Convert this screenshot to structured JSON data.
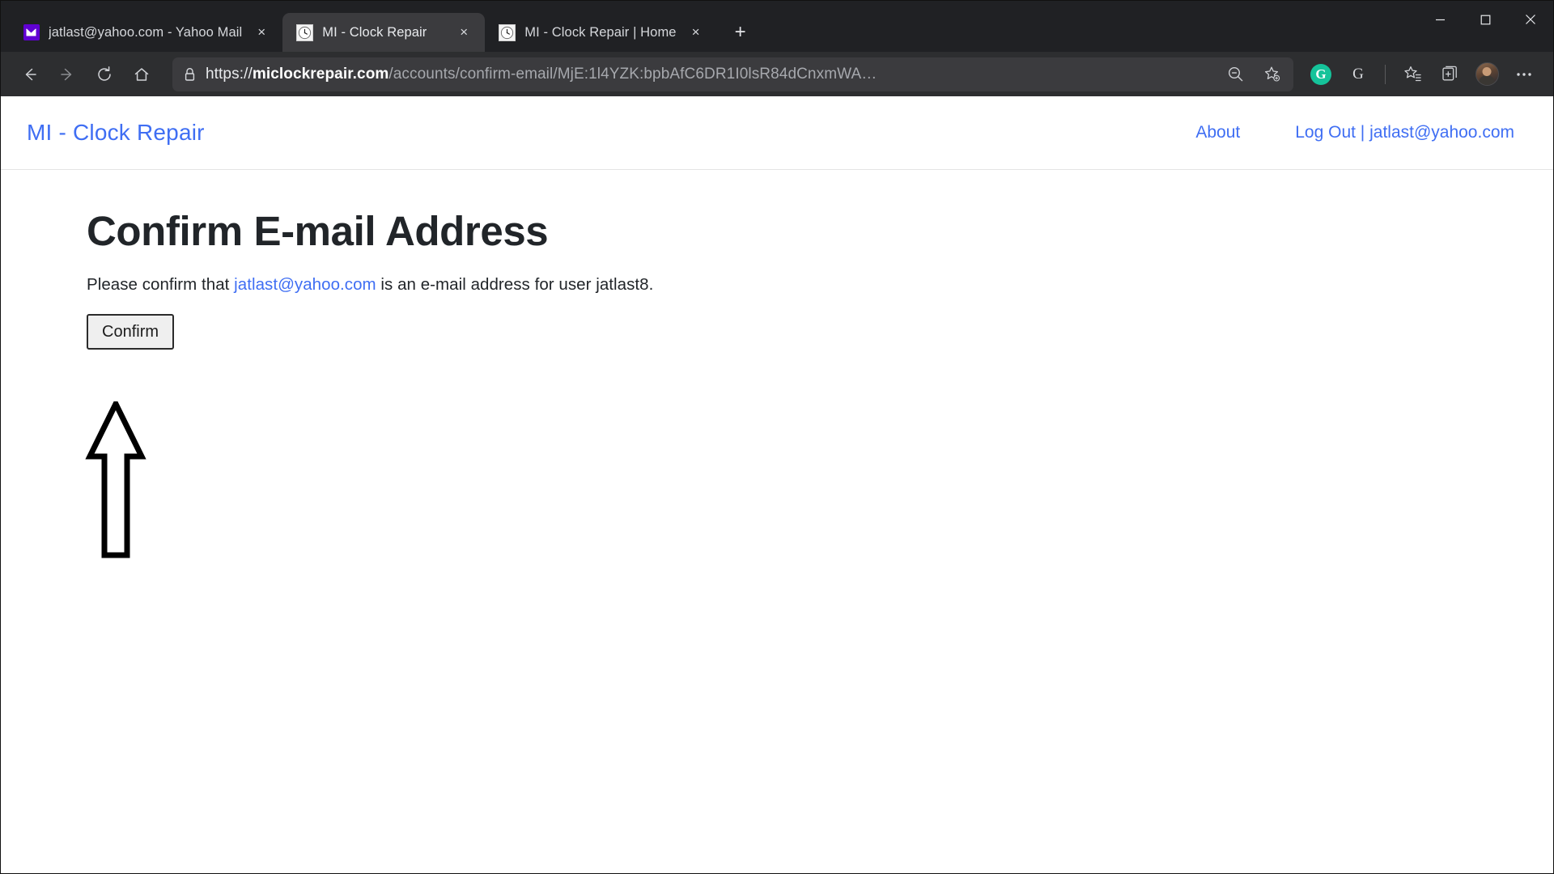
{
  "browser": {
    "tabs": [
      {
        "title": "jatlast@yahoo.com - Yahoo Mail",
        "favicon": "mail-icon",
        "active": false,
        "close_label": "×"
      },
      {
        "title": "MI - Clock Repair",
        "favicon": "clock-icon",
        "active": true,
        "close_label": "×"
      },
      {
        "title": "MI - Clock Repair | Home",
        "favicon": "clock-icon",
        "active": false,
        "close_label": "×"
      }
    ],
    "new_tab_label": "+",
    "window_controls": {
      "minimize": "—",
      "maximize": "☐",
      "close": "✕"
    },
    "toolbar": {
      "back_label": "←",
      "forward_label": "→",
      "refresh_label": "↻",
      "home_label": "⌂",
      "url": {
        "scheme": "https://",
        "host": "miclockrepair.com",
        "path": "/accounts/confirm-email/MjE:1l4YZK:bpbAfC6DR1I0lsR84dCnxmWA…",
        "full": "https://miclockrepair.com/accounts/confirm-email/MjE:1l4YZK:bpbAfC6DR1I0lsR84dCnxmWA…",
        "lock_icon": "lock-icon"
      },
      "zoom_out_icon": "zoom-out-icon",
      "favorite_icon": "favorites-add-icon",
      "grammarly_label": "G",
      "grammarly_color": "#15c39a",
      "second_g_label": "G",
      "collections_icon": "collections-icon",
      "favorites_bar_icon": "favorites-list-icon",
      "profile_icon": "profile-avatar",
      "settings_label": "⋯"
    }
  },
  "page": {
    "brand": "MI - Clock Repair",
    "nav": [
      {
        "label": "About"
      },
      {
        "label": "Log Out | jatlast@yahoo.com"
      }
    ],
    "title": "Confirm E-mail Address",
    "lead_before": "Please confirm that ",
    "lead_email": "jatlast@yahoo.com",
    "lead_after": " is an e-mail address for user jatlast8.",
    "confirm_button": "Confirm",
    "annotation": "up-arrow-pointing-to-confirm-button",
    "link_color": "#3f6ef3",
    "text_color": "#212529"
  }
}
